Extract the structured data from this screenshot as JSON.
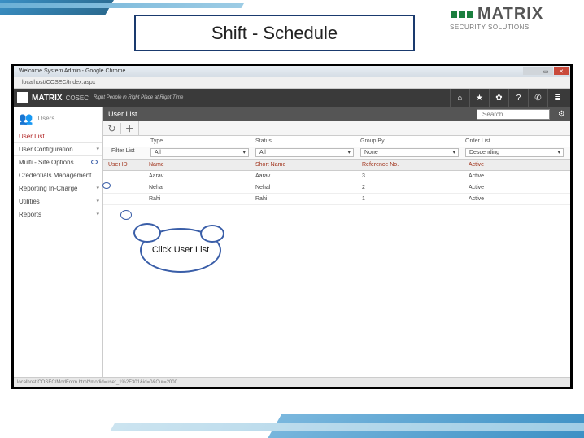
{
  "slide": {
    "title": "Shift - Schedule",
    "brand": "MATRIX",
    "brand_sub": "SECURITY SOLUTIONS"
  },
  "chrome": {
    "title": "Welcome System Admin - Google Chrome",
    "tab": "localhost/COSEC/Index.aspx",
    "status": "localhost/COSEC/ModForm.html?modid=user_1%2F301&id=0&Cur=2000"
  },
  "app": {
    "brand": "MATRIX",
    "product": "COSEC",
    "tagline": "Right People in Right Place at Right Time",
    "search_placeholder": "Search"
  },
  "sidebar": {
    "head": "Users",
    "items": [
      {
        "label": "User List"
      },
      {
        "label": "User Configuration"
      },
      {
        "label": "Multi - Site Options"
      },
      {
        "label": "Credentials Management"
      },
      {
        "label": "Reporting In-Charge"
      },
      {
        "label": "Utilities"
      },
      {
        "label": "Reports"
      }
    ]
  },
  "main": {
    "title": "User List",
    "filters": {
      "header_labels": [
        "Type",
        "Status",
        "Group By",
        "Order List"
      ],
      "label": "Filter List",
      "type": "All",
      "status": "All",
      "group_by": "None",
      "order": "Descending"
    },
    "columns": [
      "User ID",
      "Name",
      "Short Name",
      "Reference No.",
      "Active"
    ],
    "rows": [
      {
        "id": "",
        "name": "Aarav",
        "short": "Aarav",
        "ref": "3",
        "active": "Active"
      },
      {
        "id": "",
        "name": "Nehal",
        "short": "Nehal",
        "ref": "2",
        "active": "Active"
      },
      {
        "id": "",
        "name": "Rahi",
        "short": "Rahi",
        "ref": "1",
        "active": "Active"
      }
    ]
  },
  "callout": {
    "text": "Click User List"
  }
}
